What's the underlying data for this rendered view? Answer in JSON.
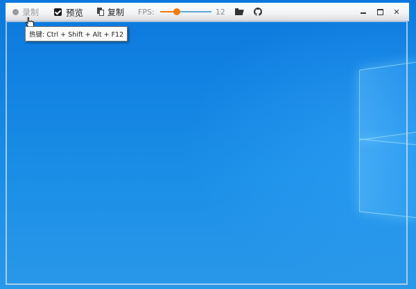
{
  "toolbar": {
    "record_label": "录制",
    "preview_label": "预览",
    "copy_label": "复制",
    "fps_label": "FPS:",
    "fps_value": "12",
    "fps_slider_fraction": 0.33
  },
  "tooltip": {
    "text": "热键: Ctrl + Shift + Alt + F12"
  },
  "window_controls": {
    "close_symbol": "✕"
  },
  "icons": [
    "record-dot-icon",
    "checkbox-icon",
    "copy-icon",
    "folder-icon",
    "github-icon",
    "minimize-icon",
    "maximize-icon",
    "close-icon",
    "hand-cursor-icon",
    "windows-logo"
  ],
  "colors": {
    "accent": "#f07b10",
    "slider_track": "#5aa9d6",
    "desktop_blue": "#1a86d8"
  }
}
